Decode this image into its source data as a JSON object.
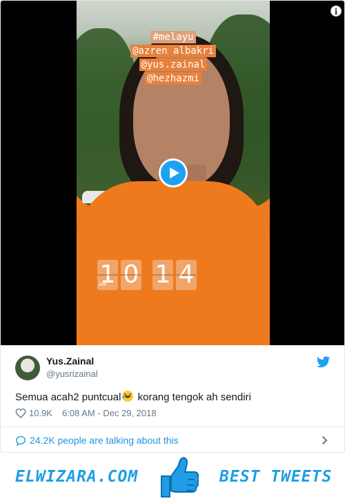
{
  "video": {
    "tags": [
      "#melayu",
      "@azren albakri",
      "@yus.zainal",
      "@hezhazmi"
    ],
    "clock": {
      "hour": "10",
      "minute": "14",
      "ampm": "AM"
    },
    "play_icon": "play-icon",
    "info_icon": "info-icon",
    "info_glyph": "i"
  },
  "tweet": {
    "author_name": "Yus.Zainal",
    "author_handle": "@yusrizainal",
    "text_before": "Semua acah2 puntcual",
    "emoji": "rolling-on-the-floor-laughing",
    "text_after": " korang tengok ah sendiri",
    "likes": "10.9K",
    "timestamp": "6:08 AM - Dec 29, 2018",
    "brand_icon": "twitter-bird-icon",
    "like_icon": "heart-icon"
  },
  "conversation": {
    "label": "24.2K people are talking about this",
    "icon": "speech-bubble-icon"
  },
  "banner": {
    "left_text": "ELWIZARA.COM",
    "right_text": "BEST TWEETS",
    "icon": "thumbs-up-icon"
  },
  "colors": {
    "accent": "#1da1f2",
    "link": "#1b95e0",
    "muted": "#657786",
    "shirt": "#ef7a1d"
  }
}
